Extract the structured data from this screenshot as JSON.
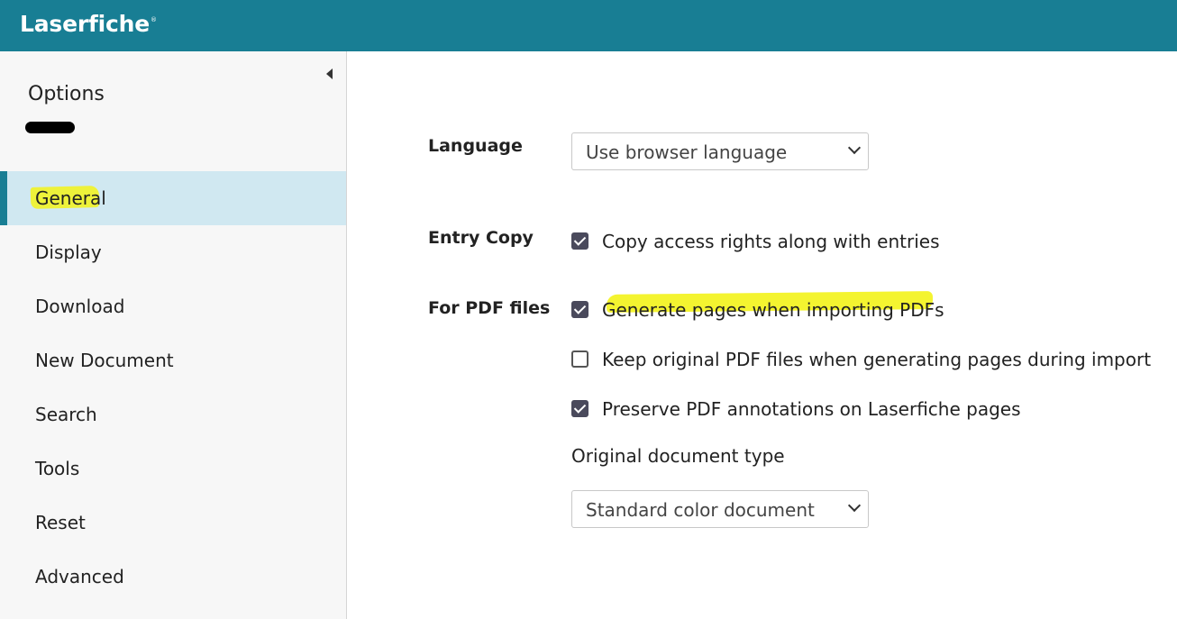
{
  "app": {
    "logo": "Laserfiche",
    "logo_mark": "®"
  },
  "sidebar": {
    "title": "Options",
    "collapse_icon": "caret-left-icon",
    "items": [
      {
        "label": "General",
        "active": true
      },
      {
        "label": "Display"
      },
      {
        "label": "Download"
      },
      {
        "label": "New Document"
      },
      {
        "label": "Search"
      },
      {
        "label": "Tools"
      },
      {
        "label": "Reset"
      },
      {
        "label": "Advanced"
      }
    ]
  },
  "main": {
    "language": {
      "label": "Language",
      "value": "Use browser language"
    },
    "entry_copy": {
      "label": "Entry Copy",
      "options": [
        {
          "text": "Copy access rights along with entries",
          "checked": true
        }
      ]
    },
    "pdf": {
      "label": "For PDF files",
      "options": [
        {
          "text": "Generate pages when importing PDFs",
          "checked": true
        },
        {
          "text": "Keep original PDF files when generating pages during import",
          "checked": false
        },
        {
          "text": "Preserve PDF annotations on Laserfiche pages",
          "checked": true
        }
      ],
      "doc_type_label": "Original document type",
      "doc_type_value": "Standard color document"
    }
  },
  "colors": {
    "header": "#187e94",
    "active_item_bg": "#d0e8f1",
    "highlight": "#f3f31a",
    "checkbox": "#4a4a5c"
  }
}
